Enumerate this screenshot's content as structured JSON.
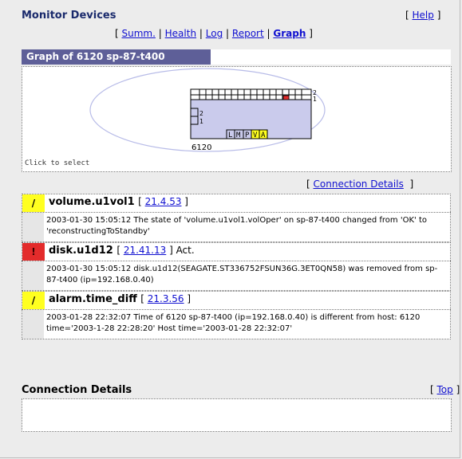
{
  "header": {
    "title": "Monitor Devices",
    "help": {
      "open": "[",
      "label": "Help",
      "close": "]"
    },
    "nav": {
      "open": "[",
      "items": [
        "Summ.",
        "Health",
        "Log",
        "Report",
        "Graph"
      ],
      "sep": "|",
      "close": "]",
      "active": "Graph"
    }
  },
  "graph": {
    "title": "Graph of 6120 sp-87-t400",
    "device_label": "6120",
    "click_hint": "Click to select",
    "row_labels_right": [
      "2",
      "1"
    ],
    "row_labels_left": [
      "2",
      "1"
    ],
    "ports": [
      {
        "label": "L",
        "status": "normal"
      },
      {
        "label": "M",
        "status": "normal"
      },
      {
        "label": "P",
        "status": "normal"
      },
      {
        "label": "V",
        "status": "warning"
      },
      {
        "label": "A",
        "status": "warning"
      }
    ],
    "colors": {
      "chassis": "#cacbec",
      "alarm": "#e32b2b",
      "warning": "#ffff20",
      "ellipse": "#b8bce8"
    }
  },
  "connection_details_link": {
    "open": "[",
    "label": "Connection Details",
    "close": "]"
  },
  "alarms": [
    {
      "severity": "minor",
      "severity_icon": "/",
      "color": "#ffff20",
      "name": "volume.u1vol1",
      "code": "21.4.53",
      "suffix": "",
      "message": "2003-01-30 15:05:12 The state of 'volume.u1vol1.volOper' on sp-87-t400 changed from 'OK' to 'reconstructingToStandby'"
    },
    {
      "severity": "critical",
      "severity_icon": "!",
      "color": "#e32b2b",
      "name": "disk.u1d12",
      "code": "21.41.13",
      "suffix": "Act.",
      "message": "2003-01-30 15:05:12 disk.u1d12(SEAGATE.ST336752FSUN36G.3ET0QN58) was removed from sp-87-t400 (ip=192.168.0.40)"
    },
    {
      "severity": "minor",
      "severity_icon": "/",
      "color": "#ffff20",
      "name": "alarm.time_diff",
      "code": "21.3.56",
      "suffix": "",
      "message": "2003-01-28 22:32:07 Time of 6120 sp-87-t400 (ip=192.168.0.40) is different from host: 6120 time='2003-1-28 22:28:20' Host time='2003-01-28 22:32:07'"
    }
  ],
  "connection_details": {
    "title": "Connection Details",
    "top": {
      "open": "[",
      "label": "Top",
      "close": "]"
    }
  }
}
